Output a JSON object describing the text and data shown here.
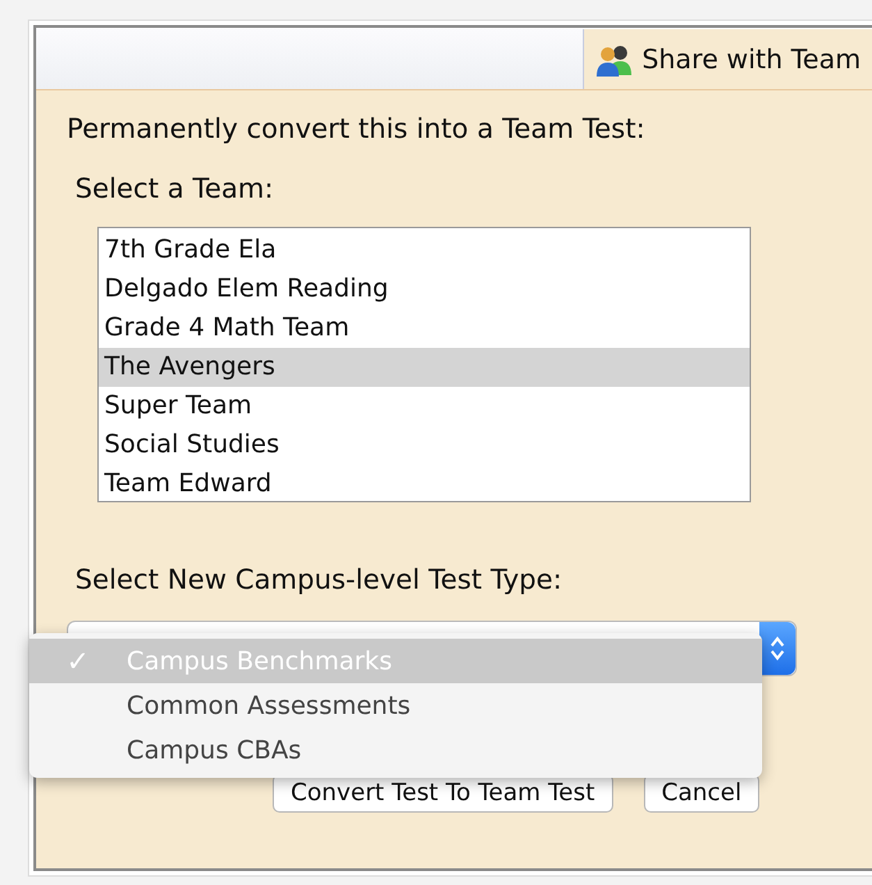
{
  "tab": {
    "label": "Share with Team",
    "selected": true
  },
  "heading": "Permanently convert this into a Team Test:",
  "team_label": "Select a Team:",
  "teams": [
    {
      "label": "7th Grade Ela",
      "selected": false
    },
    {
      "label": "Delgado Elem Reading",
      "selected": false
    },
    {
      "label": "Grade 4 Math Team",
      "selected": false
    },
    {
      "label": "The Avengers",
      "selected": true
    },
    {
      "label": "Super Team",
      "selected": false
    },
    {
      "label": "Social Studies",
      "selected": false
    },
    {
      "label": "Team Edward",
      "selected": false
    }
  ],
  "type_label": "Select New Campus-level Test Type:",
  "type_menu": {
    "check": "✓",
    "options": [
      {
        "label": "Campus Benchmarks",
        "selected": true
      },
      {
        "label": "Common Assessments",
        "selected": false
      },
      {
        "label": "Campus CBAs",
        "selected": false
      }
    ]
  },
  "buttons": [
    "Convert Test To Team Test",
    "Cancel"
  ]
}
